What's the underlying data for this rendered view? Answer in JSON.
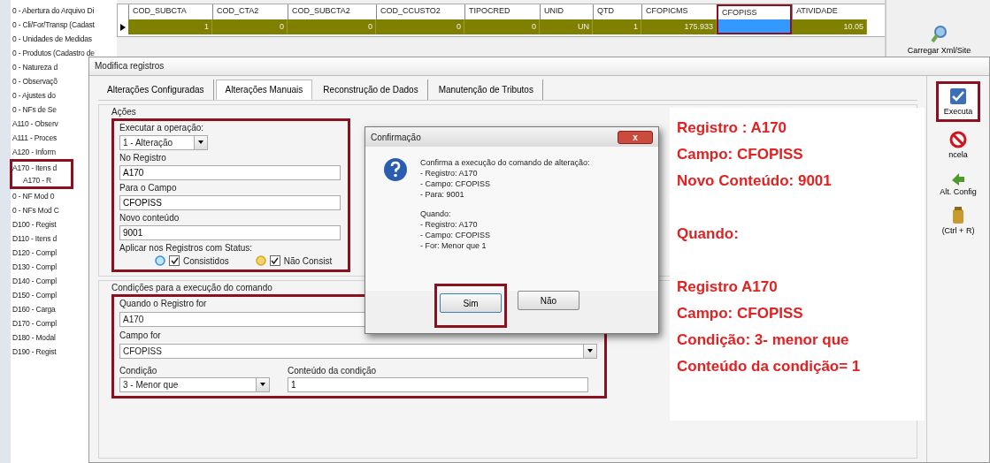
{
  "tree": {
    "items": [
      {
        "label": "0 - Abertura do Arquivo Di"
      },
      {
        "label": "0 - Cli/For/Transp (Cadast"
      },
      {
        "label": "0 - Unidades de Medidas"
      },
      {
        "label": "0 - Produtos (Cadastro de"
      },
      {
        "label": "0 - Natureza d"
      },
      {
        "label": "0 - Observaçõ"
      },
      {
        "label": "0 - Ajustes do"
      },
      {
        "label": "0 - NFs de Se"
      },
      {
        "label": "A110 - Observ"
      },
      {
        "label": "A111 - Proces"
      },
      {
        "label": "A120 - Inform"
      },
      {
        "label": "A170 - Itens d",
        "children": [
          {
            "label": "A170 - R"
          }
        ]
      },
      {
        "label": "0 - NF Mod 0"
      },
      {
        "label": "0 - NFs Mod C"
      },
      {
        "label": "D100 - Regist"
      },
      {
        "label": "D110 - Itens d"
      },
      {
        "label": "D120 - Compl"
      },
      {
        "label": "D130 - Compl"
      },
      {
        "label": "D140 - Compl"
      },
      {
        "label": "D150 - Compl"
      },
      {
        "label": "D160 - Carga"
      },
      {
        "label": "D170 - Compl"
      },
      {
        "label": "D180 - Modal"
      },
      {
        "label": "D190 - Regist"
      }
    ]
  },
  "grid": {
    "columns": [
      "COD_SUBCTA",
      "COD_CTA2",
      "COD_SUBCTA2",
      "COD_CCUSTO2",
      "TIPOCRED",
      "UNID",
      "QTD",
      "CFOPICMS",
      "CFOPISS",
      "ATIVIDADE"
    ],
    "rows": [
      {
        "cells": [
          {
            "text": "1",
            "selected": false
          },
          {
            "text": "0",
            "selected": false
          },
          {
            "text": "0",
            "selected": false
          },
          {
            "text": "0",
            "selected": false
          },
          {
            "text": "0",
            "selected": false
          },
          {
            "text": "UN",
            "selected": false
          },
          {
            "text": "1",
            "selected": false
          },
          {
            "text": "175.933",
            "selected": false
          },
          {
            "selected": true
          },
          {
            "text": "10.05",
            "selected": false
          }
        ]
      }
    ]
  },
  "main_toolbar": {
    "buttons": [
      {
        "label": "Carregar Xml/Site",
        "kind": "load"
      }
    ]
  },
  "modal": {
    "title": "Modifica registros",
    "tabs": [
      {
        "label": "Alterações Configuradas",
        "selected": false
      },
      {
        "label": "Alterações Manuais",
        "selected": true
      },
      {
        "label": "Reconstrução de Dados",
        "selected": false
      },
      {
        "label": "Manutenção de Tributos",
        "selected": false
      }
    ],
    "actions": {
      "title": "Ações",
      "operation_label": "Executar a operação:",
      "operation": "1 - Alteração",
      "fields": [
        {
          "label": "No Registro",
          "value": "A170"
        },
        {
          "label": "Para o Campo",
          "value": "CFOPISS"
        },
        {
          "label": "Novo conteúdo",
          "value": "9001"
        }
      ],
      "status_label": "Aplicar nos Registros com Status:",
      "statuses": [
        {
          "label": "Consistidos",
          "checked": true,
          "kind": "ok"
        },
        {
          "label": "Não Consist",
          "checked": true,
          "kind": "warn"
        }
      ]
    },
    "conditions": {
      "title": "Condições para a execução do comando",
      "record_label": "Quando o Registro for",
      "record": "A170",
      "field_label": "Campo for",
      "field": "CFOPISS",
      "condition_label": "Condição",
      "condition": "3 - Menor que",
      "content_label": "Conteúdo da condição",
      "content": "1"
    },
    "toolbar": [
      {
        "label": "Executa",
        "kind": "execute"
      },
      {
        "label": "ncela",
        "kind": "cancel"
      },
      {
        "label": "Alt. Config",
        "kind": "config"
      },
      {
        "label": "(Ctrl + R)",
        "kind": "shortcut"
      }
    ]
  },
  "confirm": {
    "title": "Confirmação",
    "close": "x",
    "lines": [
      "Confirma a execução do comando de alteração:",
      "- Registro: A170",
      "- Campo: CFOPISS",
      "- Para: 9001"
    ],
    "when_title": "Quando:",
    "when_lines": [
      "- Registro: A170",
      "- Campo: CFOPISS",
      "- For: Menor que 1"
    ],
    "buttons": [
      "Sim",
      "Não"
    ]
  },
  "annotation": {
    "blocks": [
      [
        "Registro : A170",
        "Campo: CFOPISS",
        "Novo Conteúdo: 9001"
      ],
      [
        "Quando:"
      ],
      [
        "Registro A170",
        "Campo: CFOPISS",
        "Condição: 3- menor que",
        "Conteúdo da condição= 1"
      ]
    ]
  }
}
